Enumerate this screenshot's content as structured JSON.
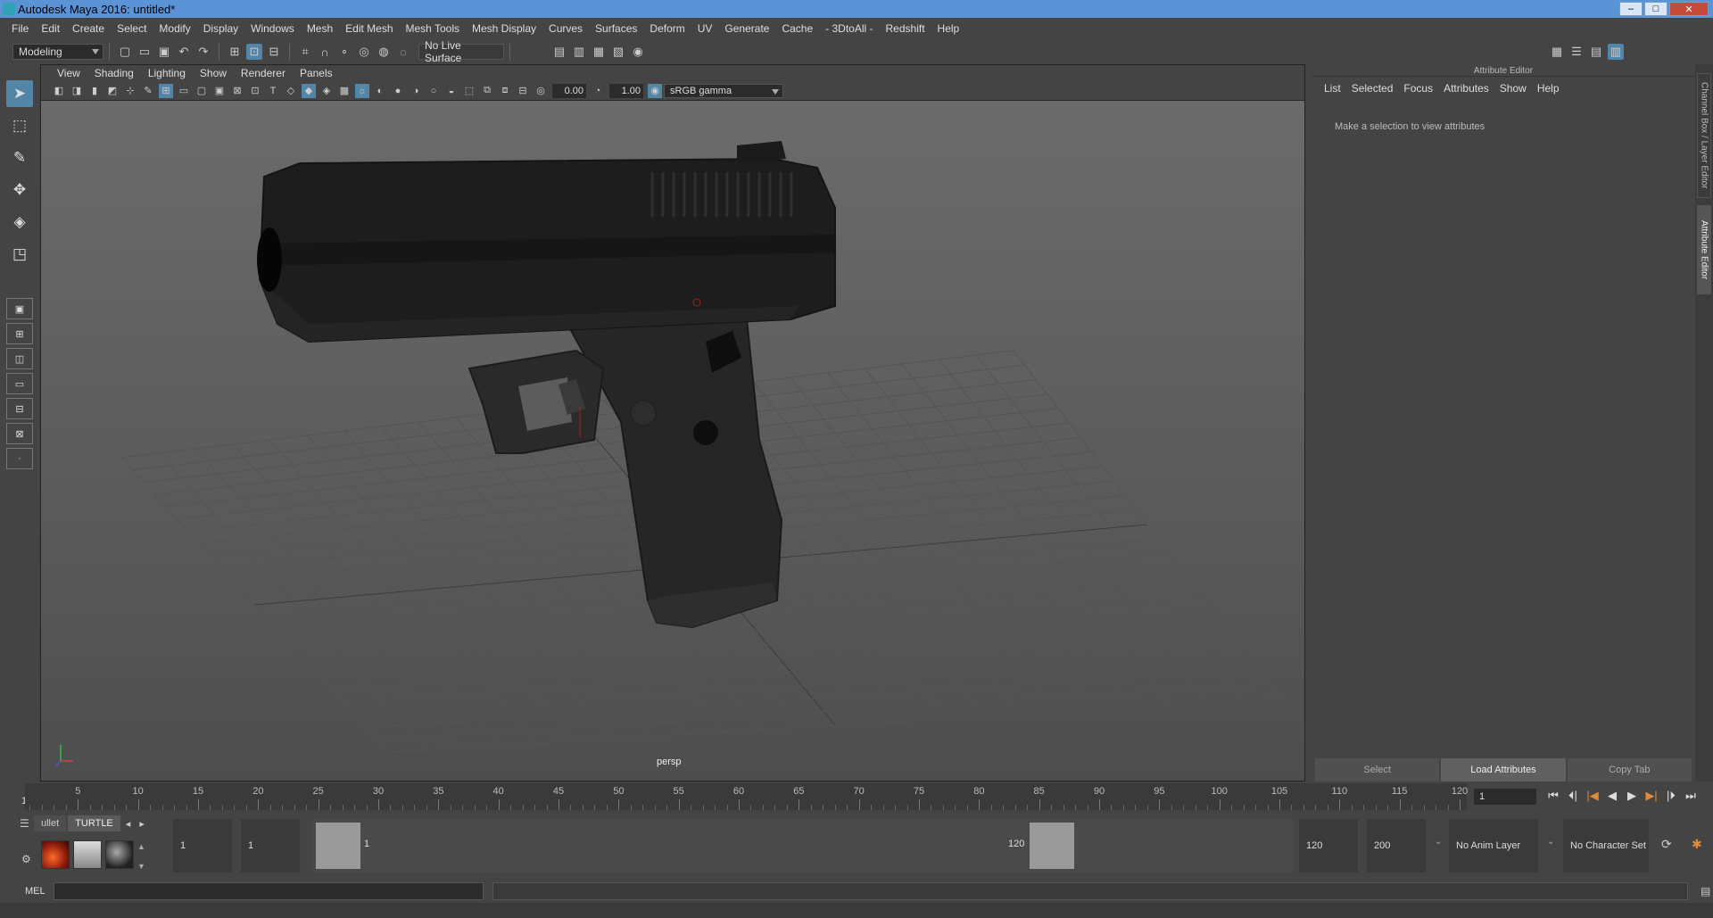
{
  "window": {
    "title": "Autodesk Maya 2016: untitled*",
    "min": "–",
    "max": "□",
    "close": "✕"
  },
  "menubar": [
    "File",
    "Edit",
    "Create",
    "Select",
    "Modify",
    "Display",
    "Windows",
    "Mesh",
    "Edit Mesh",
    "Mesh Tools",
    "Mesh Display",
    "Curves",
    "Surfaces",
    "Deform",
    "UV",
    "Generate",
    "Cache",
    "- 3DtoAll -",
    "Redshift",
    "Help"
  ],
  "statusline": {
    "menuset": "Modeling",
    "live_surface": "No Live Surface"
  },
  "viewport": {
    "menu": [
      "View",
      "Shading",
      "Lighting",
      "Show",
      "Renderer",
      "Panels"
    ],
    "exposure": "0.00",
    "gamma": "1.00",
    "colorspace": "sRGB gamma",
    "camera": "persp"
  },
  "attribute_editor": {
    "title": "Attribute Editor",
    "menu": [
      "List",
      "Selected",
      "Focus",
      "Attributes",
      "Show",
      "Help"
    ],
    "message": "Make a selection to view attributes",
    "buttons": [
      "Select",
      "Load Attributes",
      "Copy Tab"
    ]
  },
  "side_tabs": [
    "Channel Box / Layer Editor",
    "Attribute Editor"
  ],
  "timeline": {
    "labels": [
      "5",
      "10",
      "15",
      "20",
      "25",
      "30",
      "35",
      "40",
      "45",
      "50",
      "55",
      "60",
      "65",
      "70",
      "75",
      "80",
      "85",
      "90",
      "95",
      "100",
      "105",
      "110",
      "115",
      "120"
    ],
    "start_label": "1",
    "current_frame": "1",
    "controls": [
      "⏮",
      "⏴|",
      "|◀",
      "◀",
      "▶",
      "▶|",
      "|⏵",
      "⏭"
    ]
  },
  "shelf": {
    "tabs": [
      "ullet",
      "TURTLE"
    ]
  },
  "range": {
    "start": "1",
    "playback_start": "1",
    "range_start_label": "1",
    "range_end_label": "120",
    "playback_end": "120",
    "end": "200",
    "anim_layer": "No Anim Layer",
    "character_set": "No Character Set"
  },
  "cmdline": {
    "label": "MEL"
  },
  "colors": {
    "accent": "#5285a6",
    "title_bar": "#5a93d6",
    "keyframe": "#e08a3a"
  }
}
